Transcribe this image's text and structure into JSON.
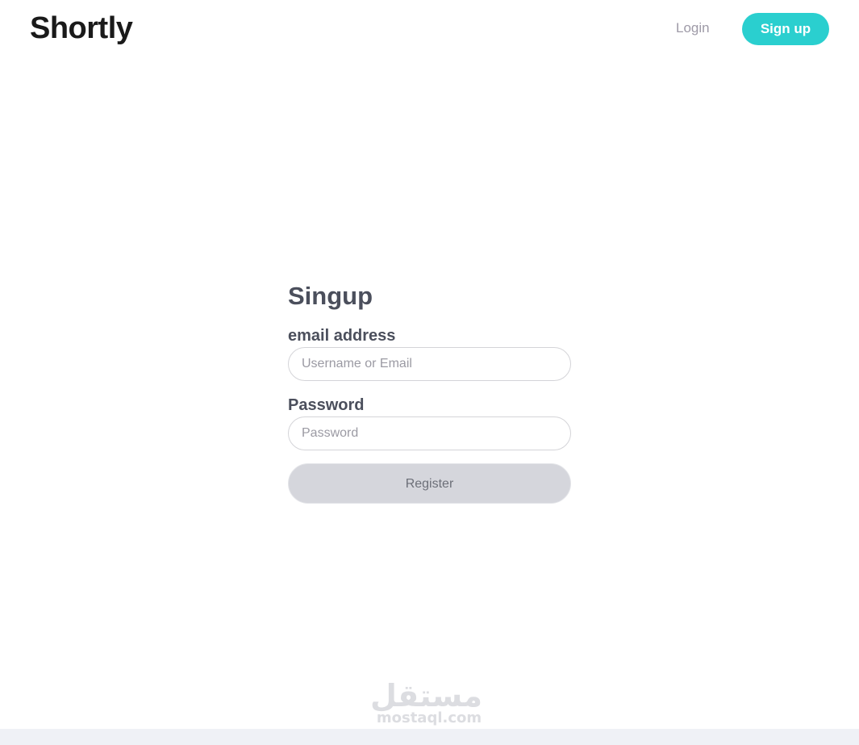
{
  "colors": {
    "accent": "#2acfcf",
    "button_bg": "#d5d6dc",
    "text_dark": "#4b4f5c",
    "muted": "#9e9aa7"
  },
  "header": {
    "logo": "Shortly",
    "login_label": "Login",
    "signup_label": "Sign up"
  },
  "form": {
    "title": "Singup",
    "email": {
      "label": "email address",
      "placeholder": "Username or Email",
      "value": ""
    },
    "password": {
      "label": "Password",
      "placeholder": "Password",
      "value": ""
    },
    "submit_label": "Register"
  },
  "watermark": {
    "arabic": "مستقل",
    "latin": "mostaql.com"
  }
}
